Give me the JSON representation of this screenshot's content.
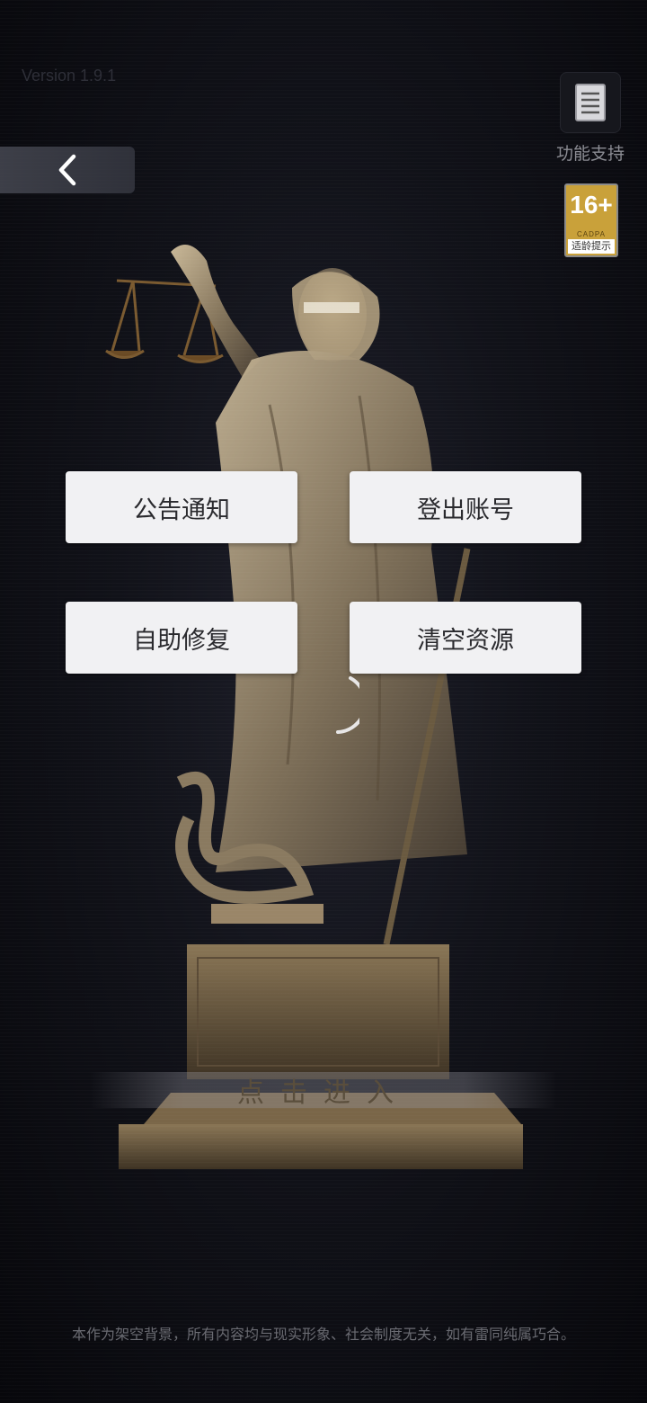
{
  "version_text": "Version 1.9.1",
  "support": {
    "icon": "document-icon",
    "label": "功能支持"
  },
  "age_rating": {
    "age": "16+",
    "org": "CADPA",
    "tip": "适龄提示",
    "color": "#c9a13a"
  },
  "menu": {
    "announcement": "公告通知",
    "logout": "登出账号",
    "self_repair": "自助修复",
    "clear_resources": "清空资源"
  },
  "enter_label": "点击进入",
  "disclaimer": "本作为架空背景，所有内容均与现实形象、社会制度无关，如有雷同纯属巧合。"
}
